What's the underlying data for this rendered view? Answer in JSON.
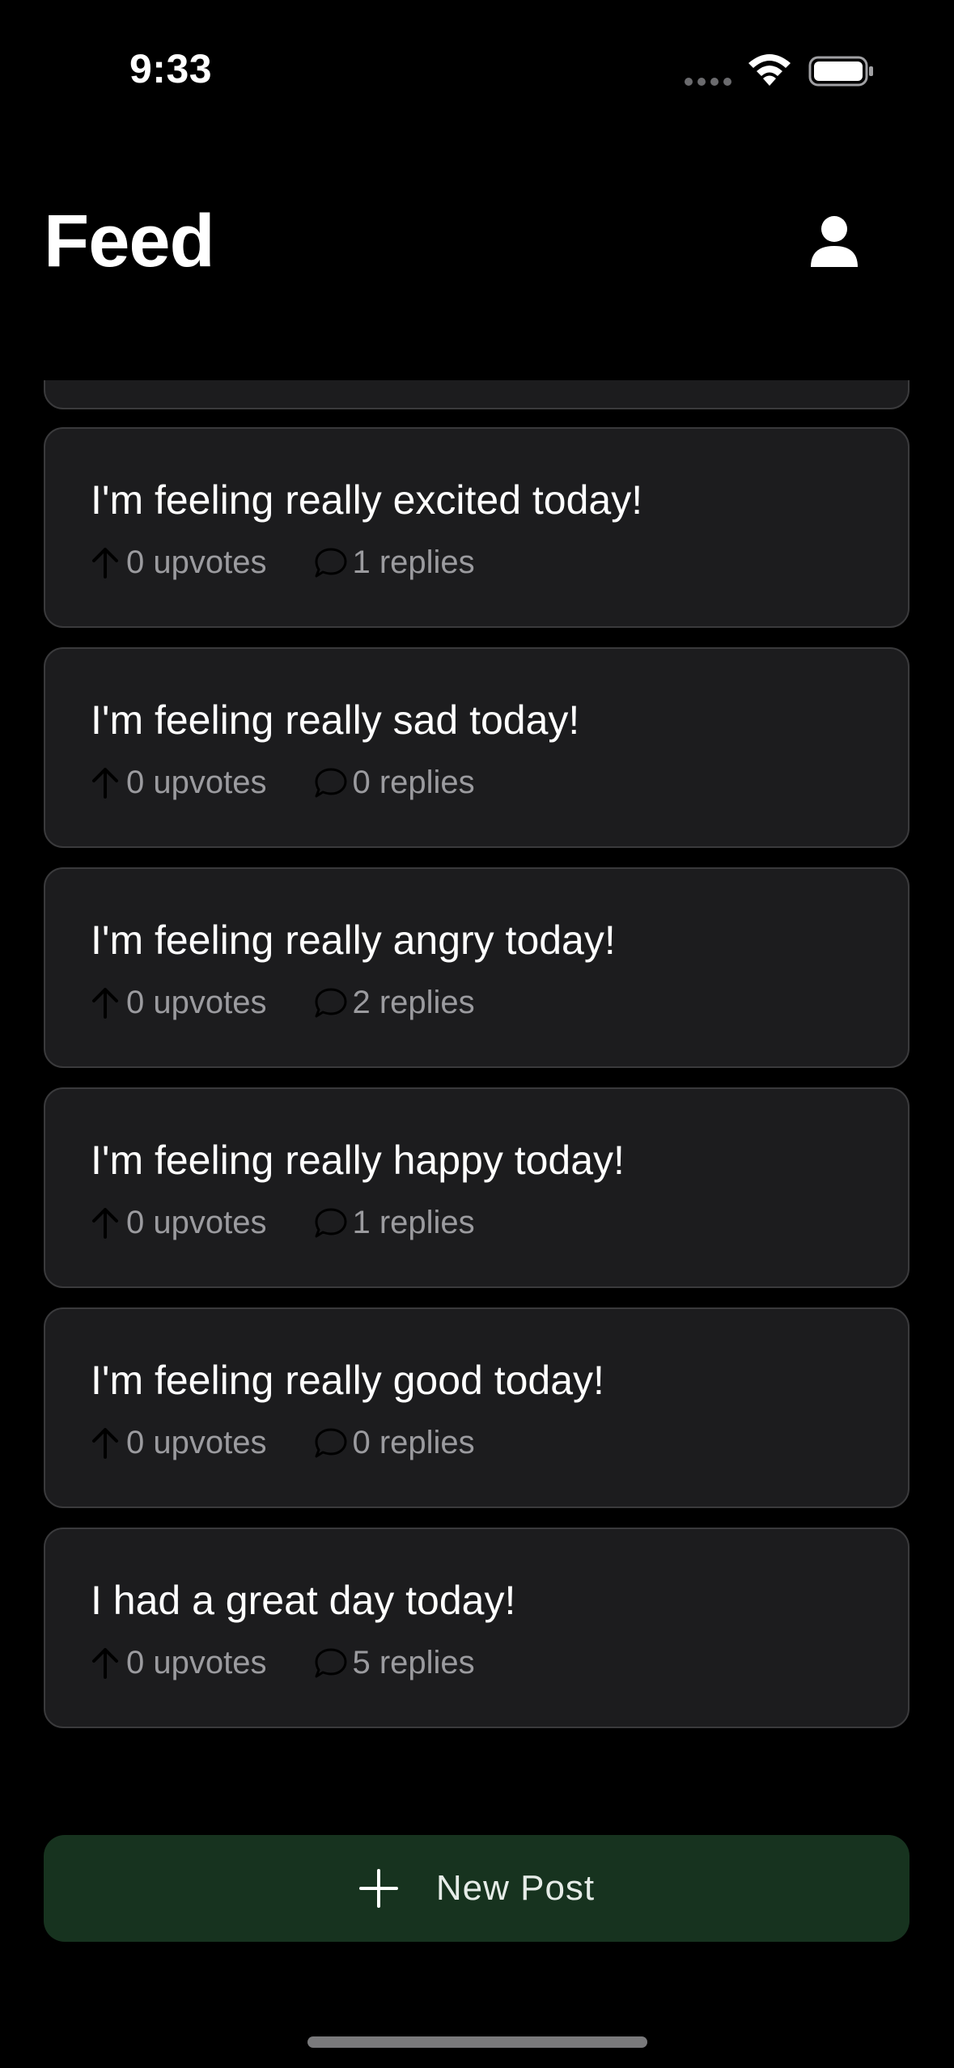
{
  "status_bar": {
    "time": "9:33"
  },
  "header": {
    "title": "Feed",
    "profile_icon": "person-icon"
  },
  "posts": [
    {
      "title": "I'm feeling really excited today!",
      "upvotes": "0 upvotes",
      "replies": "1 replies"
    },
    {
      "title": "I'm feeling really sad today!",
      "upvotes": "0 upvotes",
      "replies": "0 replies"
    },
    {
      "title": "I'm feeling really angry today!",
      "upvotes": "0 upvotes",
      "replies": "2 replies"
    },
    {
      "title": "I'm feeling really happy today!",
      "upvotes": "0 upvotes",
      "replies": "1 replies"
    },
    {
      "title": "I'm feeling really good today!",
      "upvotes": "0 upvotes",
      "replies": "0 replies"
    },
    {
      "title": "I had a great day today!",
      "upvotes": "0 upvotes",
      "replies": "5 replies"
    }
  ],
  "new_post_button": {
    "label": "New Post",
    "icon": "plus-icon"
  },
  "colors": {
    "background": "#000000",
    "card_background": "#1c1c1e",
    "card_border": "#3a3a3c",
    "meta_text": "#9b9b9f",
    "button_background": "#17331f"
  }
}
